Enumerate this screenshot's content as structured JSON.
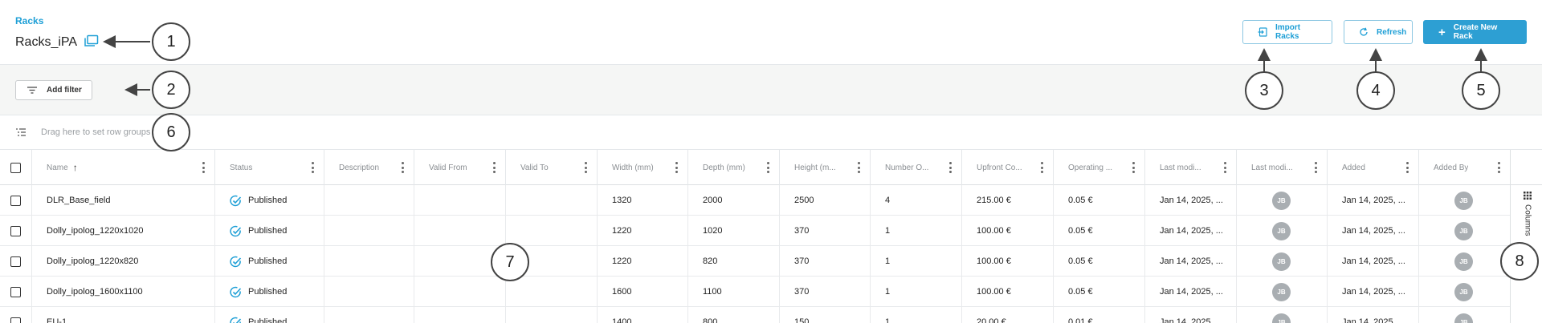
{
  "header": {
    "breadcrumb": "Racks",
    "title": "Racks_iPA",
    "title_icon": "folders-icon",
    "import_label": "Import Racks",
    "refresh_label": "Refresh",
    "create_label": "Create New Rack",
    "accent_color": "#1e9fd6"
  },
  "filters": {
    "add_filter_label": "Add filter"
  },
  "row_groups": {
    "placeholder": "Drag here to set row groups"
  },
  "grid": {
    "columns": [
      "Name",
      "Status",
      "Description",
      "Valid From",
      "Valid To",
      "Width (mm)",
      "Depth (mm)",
      "Height (m...",
      "Number O...",
      "Upfront Co...",
      "Operating ...",
      "Last modi...",
      "Last modi...",
      "Added",
      "Added By"
    ],
    "sort": {
      "column": "Name",
      "direction": "ascending"
    },
    "rows": [
      {
        "name": "DLR_Base_field",
        "status": "Published",
        "description": "",
        "valid_from": "",
        "valid_to": "",
        "width": "1320",
        "depth": "2000",
        "height": "2500",
        "number": "4",
        "upfront": "215.00 €",
        "operating": "0.05 €",
        "last_modified": "Jan 14, 2025, ...",
        "last_modified_by": "JB",
        "added": "Jan 14, 2025, ...",
        "added_by": "JB"
      },
      {
        "name": "Dolly_ipolog_1220x1020",
        "status": "Published",
        "description": "",
        "valid_from": "",
        "valid_to": "",
        "width": "1220",
        "depth": "1020",
        "height": "370",
        "number": "1",
        "upfront": "100.00 €",
        "operating": "0.05 €",
        "last_modified": "Jan 14, 2025, ...",
        "last_modified_by": "JB",
        "added": "Jan 14, 2025, ...",
        "added_by": "JB"
      },
      {
        "name": "Dolly_ipolog_1220x820",
        "status": "Published",
        "description": "",
        "valid_from": "",
        "valid_to": "",
        "width": "1220",
        "depth": "820",
        "height": "370",
        "number": "1",
        "upfront": "100.00 €",
        "operating": "0.05 €",
        "last_modified": "Jan 14, 2025, ...",
        "last_modified_by": "JB",
        "added": "Jan 14, 2025, ...",
        "added_by": "JB"
      },
      {
        "name": "Dolly_ipolog_1600x1100",
        "status": "Published",
        "description": "",
        "valid_from": "",
        "valid_to": "",
        "width": "1600",
        "depth": "1100",
        "height": "370",
        "number": "1",
        "upfront": "100.00 €",
        "operating": "0.05 €",
        "last_modified": "Jan 14, 2025, ...",
        "last_modified_by": "JB",
        "added": "Jan 14, 2025, ...",
        "added_by": "JB"
      },
      {
        "name": "EU-1",
        "status": "Published",
        "description": "",
        "valid_from": "",
        "valid_to": "",
        "width": "1400",
        "depth": "800",
        "height": "150",
        "number": "1",
        "upfront": "20.00 €",
        "operating": "0.01 €",
        "last_modified": "Jan 14, 2025, ...",
        "last_modified_by": "JB",
        "added": "Jan 14, 2025, ...",
        "added_by": "JB"
      }
    ]
  },
  "side_panel": {
    "columns_label": "Columns"
  },
  "callouts": [
    "1",
    "2",
    "3",
    "4",
    "5",
    "6",
    "7",
    "8"
  ]
}
